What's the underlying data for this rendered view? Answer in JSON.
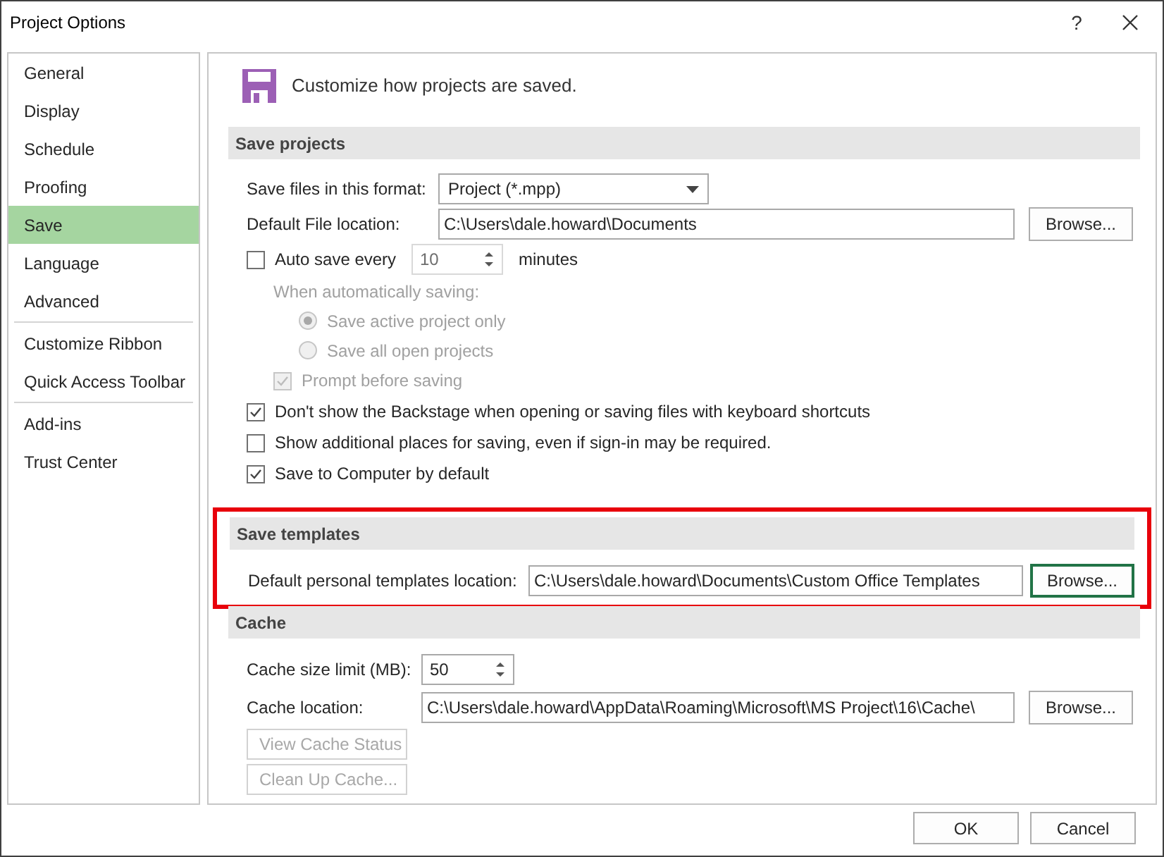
{
  "window": {
    "title": "Project Options",
    "help": "?"
  },
  "sidebar": {
    "groups": [
      {
        "items": [
          {
            "label": "General",
            "selected": false
          },
          {
            "label": "Display",
            "selected": false
          },
          {
            "label": "Schedule",
            "selected": false
          },
          {
            "label": "Proofing",
            "selected": false
          },
          {
            "label": "Save",
            "selected": true
          },
          {
            "label": "Language",
            "selected": false
          },
          {
            "label": "Advanced",
            "selected": false
          }
        ]
      },
      {
        "items": [
          {
            "label": "Customize Ribbon",
            "selected": false
          },
          {
            "label": "Quick Access Toolbar",
            "selected": false
          }
        ]
      },
      {
        "items": [
          {
            "label": "Add-ins",
            "selected": false
          },
          {
            "label": "Trust Center",
            "selected": false
          }
        ]
      }
    ]
  },
  "header": "Customize how projects are saved.",
  "save_projects": {
    "title": "Save projects",
    "format": {
      "label": "Save files in this format:",
      "value": "Project (*.mpp)"
    },
    "file_location": {
      "label": "Default File location:",
      "value": "C:\\Users\\dale.howard\\Documents",
      "button": "Browse..."
    },
    "auto_save": {
      "label": "Auto save every",
      "checked": false,
      "value": "10",
      "unit": "minutes"
    },
    "auto_saving": {
      "label": "When automatically saving:",
      "options": [
        {
          "label": "Save active project only",
          "selected": true,
          "disabled": true
        },
        {
          "label": "Save all open projects",
          "selected": false,
          "disabled": true
        }
      ],
      "prompt": {
        "label": "Prompt before saving",
        "checked": true,
        "disabled": true
      }
    },
    "checks": [
      {
        "label": "Don't show the Backstage when opening or saving files with keyboard shortcuts",
        "checked": true
      },
      {
        "label": "Show additional places for saving, even if sign-in may be required.",
        "checked": false
      },
      {
        "label": "Save to Computer by default",
        "checked": true
      }
    ]
  },
  "save_templates": {
    "title": "Save templates",
    "highlighted": true,
    "location": {
      "label": "Default personal templates location:",
      "value": "C:\\Users\\dale.howard\\Documents\\Custom Office Templates",
      "button": "Browse...",
      "focused": true
    }
  },
  "cache": {
    "title": "Cache",
    "size": {
      "label": "Cache size limit (MB):",
      "value": "50"
    },
    "location": {
      "label": "Cache location:",
      "value": "C:\\Users\\dale.howard\\AppData\\Roaming\\Microsoft\\MS Project\\16\\Cache\\",
      "button": "Browse..."
    },
    "buttons": [
      {
        "label": "View Cache Status",
        "disabled": true
      },
      {
        "label": "Clean Up Cache...",
        "disabled": true
      }
    ]
  },
  "footer": {
    "buttons": [
      "OK",
      "Cancel"
    ]
  }
}
